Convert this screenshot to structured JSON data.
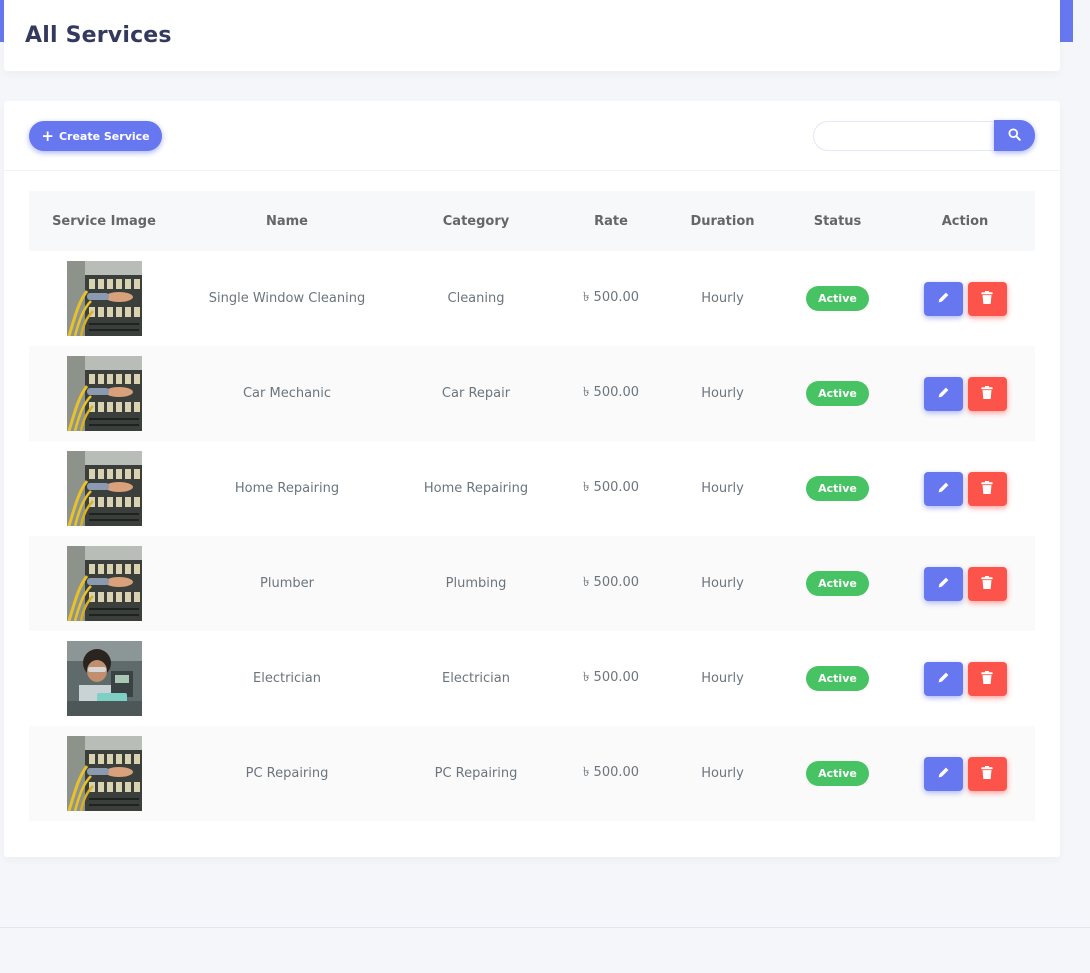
{
  "page": {
    "title": "All Services"
  },
  "toolbar": {
    "create_label": "Create Service",
    "create_icon": "plus-icon",
    "search_placeholder": "",
    "search_value": "",
    "search_icon": "search-icon"
  },
  "table": {
    "headers": [
      "Service Image",
      "Name",
      "Category",
      "Rate",
      "Duration",
      "Status",
      "Action"
    ],
    "rows": [
      {
        "image": "electrical-panel",
        "name": "Single Window Cleaning",
        "category": "Cleaning",
        "rate": "৳ 500.00",
        "duration": "Hourly",
        "status": "Active"
      },
      {
        "image": "electrical-panel",
        "name": "Car Mechanic",
        "category": "Car Repair",
        "rate": "৳ 500.00",
        "duration": "Hourly",
        "status": "Active"
      },
      {
        "image": "electrical-panel",
        "name": "Home Repairing",
        "category": "Home Repairing",
        "rate": "৳ 500.00",
        "duration": "Hourly",
        "status": "Active"
      },
      {
        "image": "electrical-panel",
        "name": "Plumber",
        "category": "Plumbing",
        "rate": "৳ 500.00",
        "duration": "Hourly",
        "status": "Active"
      },
      {
        "image": "electrician-at-work",
        "name": "Electrician",
        "category": "Electrician",
        "rate": "৳ 500.00",
        "duration": "Hourly",
        "status": "Active"
      },
      {
        "image": "electrical-panel",
        "name": "PC Repairing",
        "category": "PC Repairing",
        "rate": "৳ 500.00",
        "duration": "Hourly",
        "status": "Active"
      }
    ],
    "action_icons": [
      "pencil-icon",
      "trash-icon"
    ]
  },
  "colors": {
    "primary": "#6777ef",
    "success": "#47c363",
    "danger": "#fc544b",
    "background": "#f4f6f9"
  }
}
